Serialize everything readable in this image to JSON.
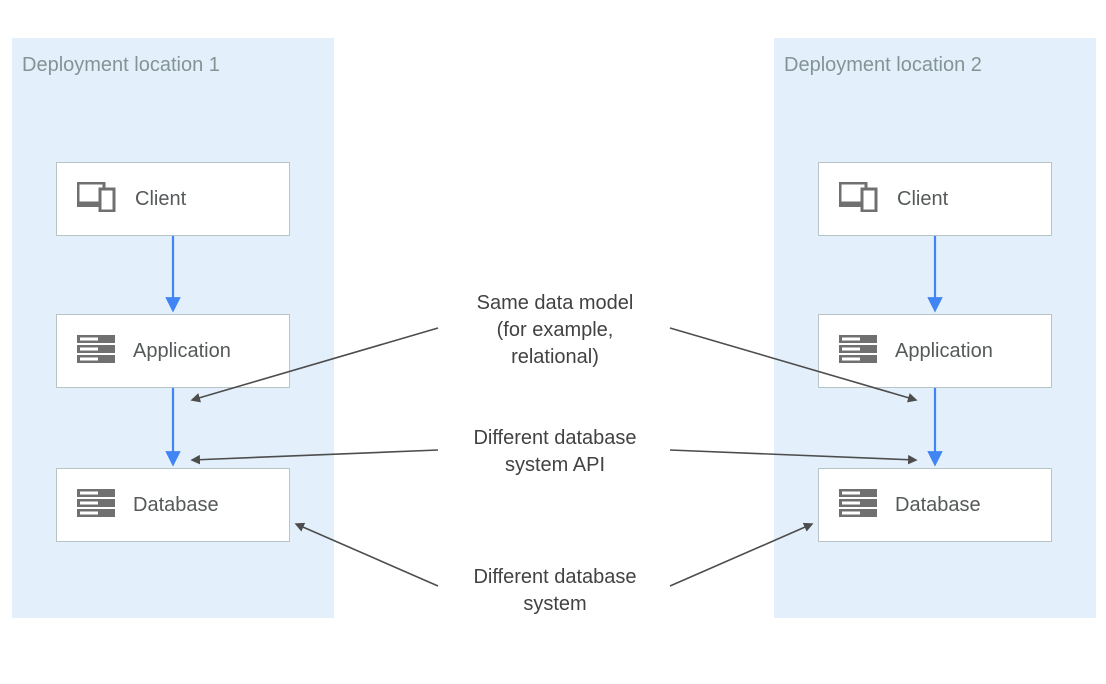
{
  "panels": {
    "left": {
      "title": "Deployment location 1"
    },
    "right": {
      "title": "Deployment location 2"
    }
  },
  "tiers": {
    "client": "Client",
    "application": "Application",
    "database": "Database"
  },
  "annotations": {
    "data_model": "Same data model\n(for example,\nrelational)",
    "api": "Different database\nsystem API",
    "system": "Different database\nsystem"
  }
}
